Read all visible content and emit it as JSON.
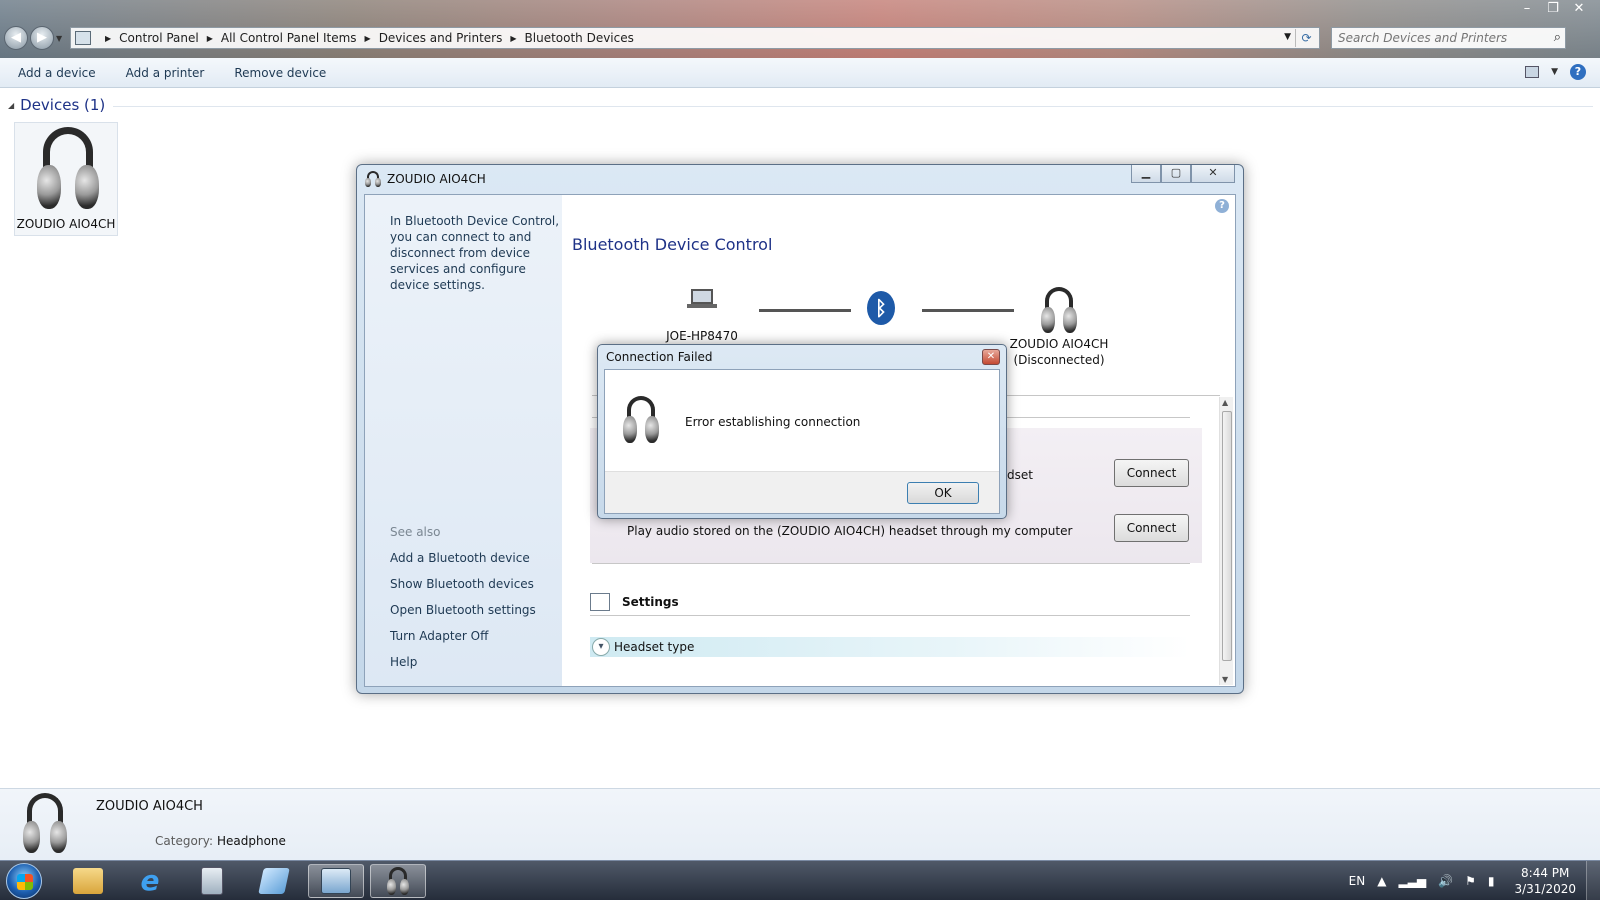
{
  "window": {
    "controls": [
      "–",
      "❐",
      "✕"
    ]
  },
  "address": {
    "crumbs": [
      "Control Panel",
      "All Control Panel Items",
      "Devices and Printers",
      "Bluetooth Devices"
    ]
  },
  "search": {
    "placeholder": "Search Devices and Printers"
  },
  "commandbar": {
    "add_device": "Add a device",
    "add_printer": "Add a printer",
    "remove_device": "Remove device"
  },
  "devices": {
    "group_title": "Devices (1)",
    "items": [
      {
        "label": "ZOUDIO AIO4CH",
        "icon": "headphone-icon"
      }
    ]
  },
  "details": {
    "name": "ZOUDIO AIO4CH",
    "category_label": "Category:",
    "category_value": "Headphone"
  },
  "btcontrol": {
    "title": "ZOUDIO AIO4CH",
    "heading": "Bluetooth Device Control",
    "intro": "In Bluetooth Device Control, you can connect to and disconnect from device services and configure device settings.",
    "see_also": "See also",
    "links": [
      "Add a Bluetooth device",
      "Show Bluetooth devices",
      "Open Bluetooth settings",
      "Turn Adapter Off",
      "Help"
    ],
    "computer_name": "JOE-HP8470",
    "bt_symbol": "ᛒ",
    "device_name": "ZOUDIO AIO4CH",
    "device_status": "(Disconnected)",
    "service1_text": "dset",
    "service2_text": "Play audio stored on the (ZOUDIO AIO4CH) headset through my computer",
    "connect_label": "Connect",
    "settings_title": "Settings",
    "headset_type": "Headset type"
  },
  "dialog": {
    "title": "Connection Failed",
    "message": "Error establishing connection",
    "ok": "OK"
  },
  "taskbar": {
    "lang": "EN",
    "time": "8:44 PM",
    "date": "3/31/2020"
  },
  "colors": {
    "accent": "#1e3287",
    "bt_blue": "#1e5aa8"
  }
}
